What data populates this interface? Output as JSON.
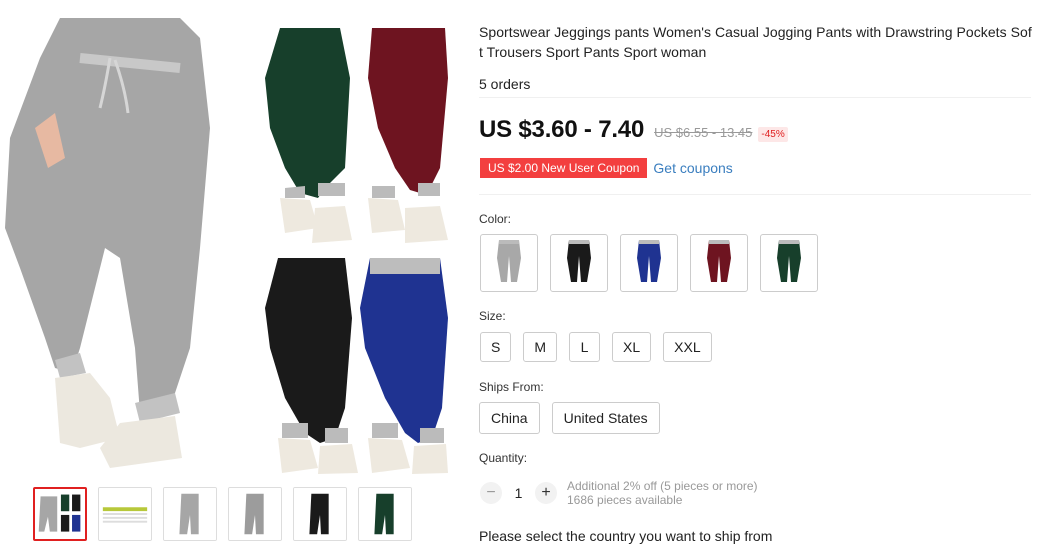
{
  "product": {
    "title": "Sportswear Jeggings pants Women's Casual Jogging Pants with Drawstring Pockets Soft Trousers Sport Pants Sport woman",
    "orders": "5 orders",
    "price": "US $3.60 - 7.40",
    "old_price": "US $6.55 - 13.45",
    "discount": "-45%"
  },
  "coupon": {
    "label": "US $2.00 New User Coupon",
    "get_label": "Get coupons"
  },
  "color": {
    "label": "Color:",
    "options": [
      "grey",
      "black",
      "navy",
      "burgundy",
      "green"
    ],
    "hex": {
      "grey": "#a8a8a8",
      "black": "#1a1a1a",
      "navy": "#1f3391",
      "burgundy": "#6e1420",
      "green": "#173f2b"
    }
  },
  "size": {
    "label": "Size:",
    "options": [
      "S",
      "M",
      "L",
      "XL",
      "XXL"
    ]
  },
  "ships_from": {
    "label": "Ships From:",
    "options": [
      "China",
      "United States"
    ]
  },
  "quantity": {
    "label": "Quantity:",
    "minus": "−",
    "value": "1",
    "plus": "+",
    "note_line1": "Additional 2% off (5 pieces or more)",
    "note_line2": "1686 pieces available"
  },
  "ship_message": "Please select the country you want to ship from",
  "theme": {
    "accent_red": "#f33f3f",
    "link_blue": "#3a7ebf"
  }
}
